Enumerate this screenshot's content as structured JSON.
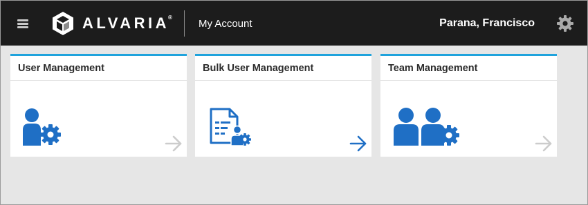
{
  "header": {
    "app_title": "My Account",
    "user_name": "Parana, Francisco",
    "logo_text": "ALVARIA",
    "logo_mark": "®",
    "background": "#1c1c1c"
  },
  "cards": [
    {
      "title": "User Management",
      "icon": "user-settings-icon",
      "arrow_color": "#cccccc"
    },
    {
      "title": "Bulk User Management",
      "icon": "bulk-document-user-icon",
      "arrow_color": "#1f6fc5"
    },
    {
      "title": "Team Management",
      "icon": "team-settings-icon",
      "arrow_color": "#cccccc"
    }
  ],
  "colors": {
    "accent_blue": "#1f6fc5",
    "card_top_border": "#20a3dc",
    "page_background": "#e6e6e6"
  }
}
